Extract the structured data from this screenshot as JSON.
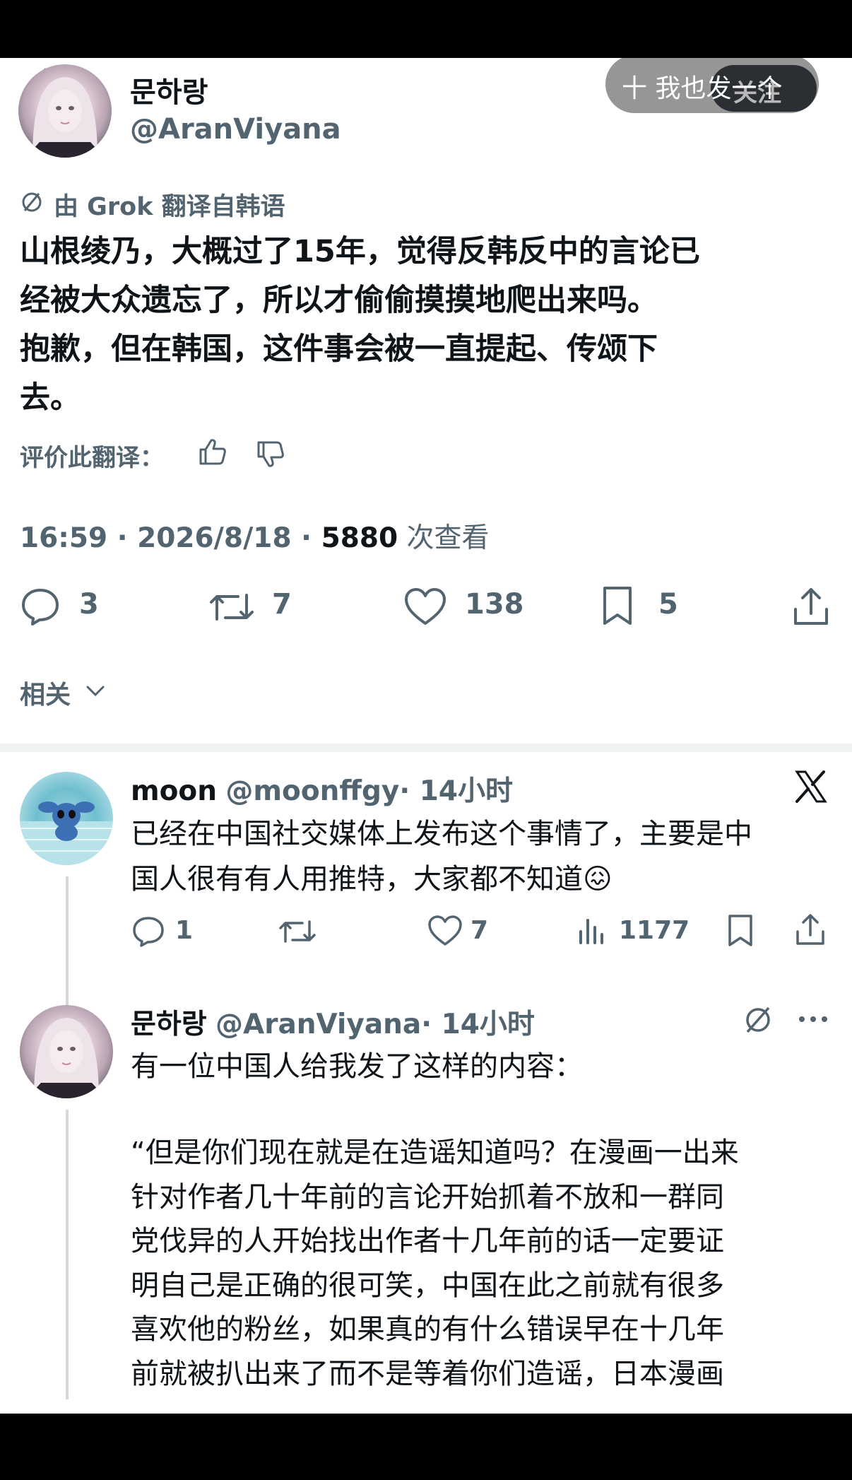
{
  "post": {
    "display_name": "문하랑",
    "handle": "@AranViyana",
    "share_button_label": "十 我也发一个",
    "follow_label": "关注",
    "translation_note": "由 Grok 翻译自韩语",
    "body": [
      "山根绫乃，大概过了15年，觉得反韩反中的言论已",
      "经被大众遗忘了，所以才偷偷摸摸地爬出来吗。",
      "抱歉，但在韩国，这件事会被一直提起、传颂下",
      "去。"
    ],
    "rate_translation_label": "评价此翻译：",
    "time": "16:59",
    "date": "2026/8/18",
    "views_count": "5880",
    "views_label": "次查看",
    "replies": "3",
    "reposts": "7",
    "likes": "138",
    "bookmarks": "5",
    "related_label": "相关"
  },
  "reply1": {
    "display_name": "moon",
    "handle": "@moonffgy",
    "time": "· 14小时",
    "lines": [
      "已经在中国社交媒体上发布这个事情了，主要是中",
      "国人很有有人用推特，大家都不知道😖"
    ],
    "replies": "1",
    "likes": "7",
    "views": "1177"
  },
  "reply2": {
    "display_name": "문하랑",
    "handle": "@AranViyana",
    "time": "· 14小时",
    "intro": "有一位中国人给我发了这样的内容：",
    "quote": [
      "“但是你们现在就是在造谣知道吗？在漫画一出来",
      "针对作者几十年前的言论开始抓着不放和一群同",
      "党伐异的人开始找出作者十几年前的话一定要证",
      "明自己是正确的很可笑，中国在此之前就有很多",
      "喜欢他的粉丝，如果真的有什么错误早在十几年",
      "前就被扒出来了而不是等着你们造谣，日本漫画"
    ]
  },
  "colors": {
    "text": "#0f1419",
    "muted": "#536471",
    "divider": "#eff3f4"
  },
  "icons": [
    "back-arrow-icon",
    "grok-slash-icon",
    "thumbs-up-icon",
    "thumbs-down-icon",
    "reply-icon",
    "repost-icon",
    "like-icon",
    "bookmark-icon",
    "share-icon",
    "chevron-down-icon",
    "x-logo-icon",
    "views-icon",
    "more-icon"
  ]
}
